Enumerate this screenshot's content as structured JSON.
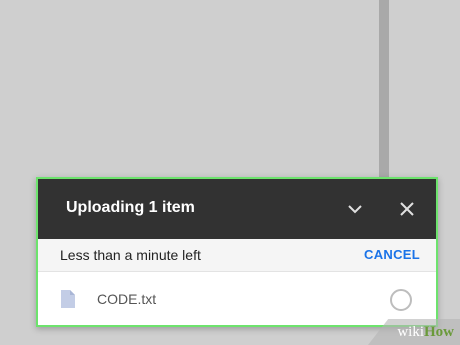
{
  "background_color": "#cfcfcf",
  "upload_panel": {
    "title": "Uploading 1 item",
    "collapse_icon": "chevron-down-icon",
    "close_icon": "close-icon",
    "status_text": "Less than a minute left",
    "cancel_label": "CANCEL",
    "files": [
      {
        "name": "CODE.txt",
        "icon": "document-icon",
        "progress": 0
      }
    ],
    "highlight_color": "#6de36d",
    "header_color": "#323232",
    "accent_color": "#1a73e8"
  },
  "watermark": {
    "part1": "wiki",
    "part2": "How"
  }
}
